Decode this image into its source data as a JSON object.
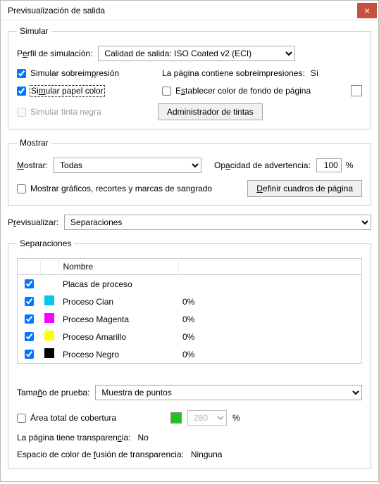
{
  "window": {
    "title": "Previsualización de salida",
    "close": "×"
  },
  "simulate": {
    "legend": "Simular",
    "profile_label_pre": "P",
    "profile_label_u": "e",
    "profile_label_post": "rfil de simulación:",
    "profile_value": "Calidad de salida: ISO Coated v2 (ECI)",
    "overprint_label_pre": "Simular sobreim",
    "overprint_label_u": "p",
    "overprint_label_post": "resión",
    "page_contains_label": "La página contiene sobreimpresiones:",
    "page_contains_value": "Sí",
    "paper_color_pre": "Si",
    "paper_color_u": "m",
    "paper_color_post": "ular papel color",
    "set_bg_pre": "E",
    "set_bg_u": "s",
    "set_bg_post": "tablecer color de fondo de página",
    "black_ink_label": "Simular tinta negra",
    "ink_manager_btn": "Administrador de tintas"
  },
  "show": {
    "legend": "Mostrar",
    "show_label_u": "M",
    "show_label_post": "ostrar:",
    "show_value": "Todas",
    "opacity_label_pre": "Op",
    "opacity_label_u": "a",
    "opacity_label_post": "cidad de advertencia:",
    "opacity_value": "100",
    "opacity_unit": "%",
    "graphics_label": "Mostrar gráficos, recortes y marcas de sangrado",
    "define_boxes_pre": "",
    "define_boxes_u": "D",
    "define_boxes_post": "efinir cuadros de página"
  },
  "preview": {
    "label_pre": "P",
    "label_u": "r",
    "label_post": "evisualizar:",
    "value": "Separaciones"
  },
  "separations": {
    "legend": "Separaciones",
    "col_blank": "",
    "col_name": "Nombre",
    "col_pct": "",
    "rows": [
      {
        "checked": true,
        "color": "",
        "name": "Placas de proceso",
        "pct": ""
      },
      {
        "checked": true,
        "color": "#00c8f0",
        "name": "Proceso Cian",
        "pct": "0%"
      },
      {
        "checked": true,
        "color": "#ff00ff",
        "name": "Proceso Magenta",
        "pct": "0%"
      },
      {
        "checked": true,
        "color": "#ffff00",
        "name": "Proceso Amarillo",
        "pct": "0%"
      },
      {
        "checked": true,
        "color": "#000000",
        "name": "Proceso Negro",
        "pct": "0%"
      }
    ]
  },
  "sample": {
    "label_pre": "Tama",
    "label_u": "ñ",
    "label_post": "o de prueba:",
    "value": "Muestra de puntos"
  },
  "coverage": {
    "label": "Área total de cobertura",
    "value": "280",
    "unit": "%"
  },
  "transparency": {
    "has_pre": "La página tiene transparen",
    "has_u": "c",
    "has_post": "ia:",
    "has_value": "No",
    "blend_pre": "Espacio de color de ",
    "blend_u": "f",
    "blend_post": "usión de transparencia:",
    "blend_value": "Ninguna"
  }
}
